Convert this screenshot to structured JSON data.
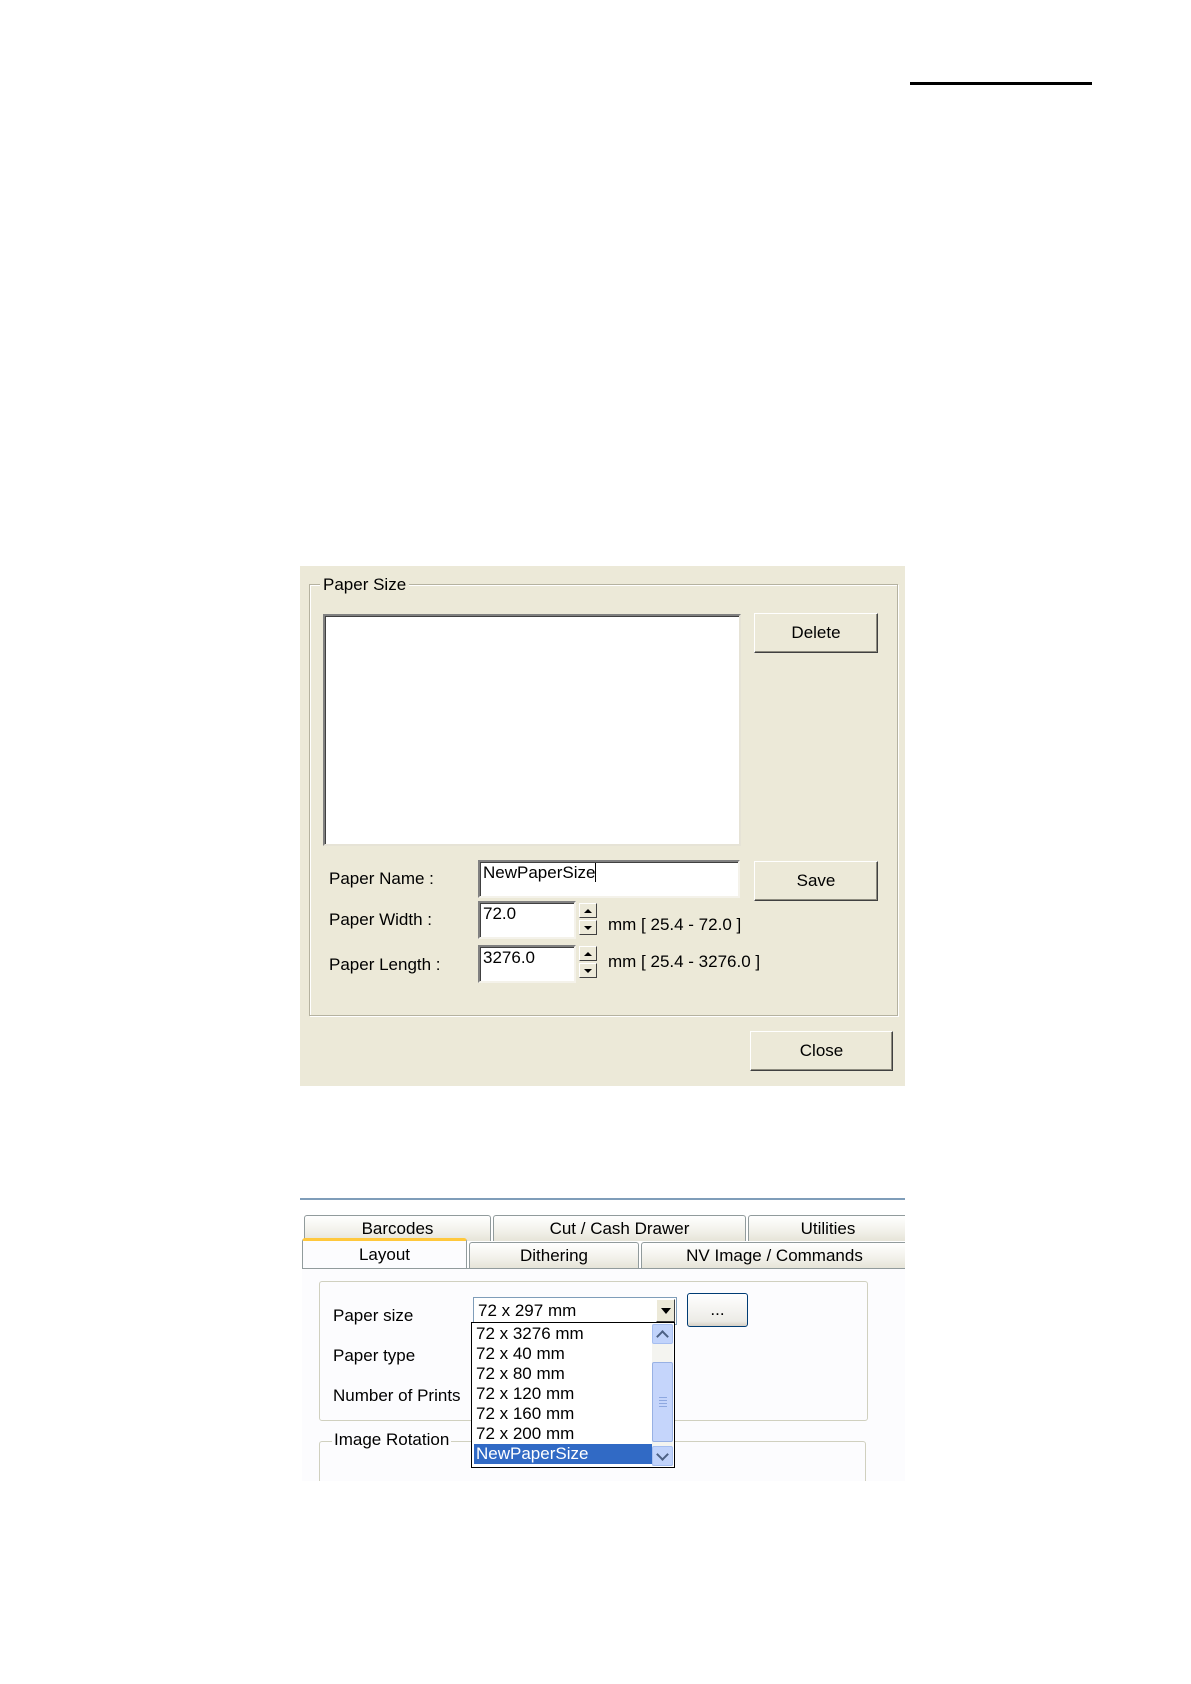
{
  "paper_size_dialog": {
    "group_title": "Paper Size",
    "delete_label": "Delete",
    "save_label": "Save",
    "close_label": "Close",
    "paper_name_label": "Paper Name :",
    "paper_name_value": "NewPaperSize",
    "paper_width_label": "Paper Width :",
    "paper_width_value": "72.0",
    "paper_width_range": "mm [ 25.4 - 72.0 ]",
    "paper_length_label": "Paper Length :",
    "paper_length_value": "3276.0",
    "paper_length_range": "mm [ 25.4 - 3276.0 ]"
  },
  "layout_dialog": {
    "tabs_row1": [
      "Barcodes",
      "Cut / Cash Drawer",
      "Utilities"
    ],
    "tabs_row2": [
      "Layout",
      "Dithering",
      "NV Image / Commands"
    ],
    "active_tab": "Layout",
    "paper_size_label": "Paper size",
    "paper_size_value": "72 x 297 mm",
    "browse_label": "...",
    "paper_type_label": "Paper type",
    "number_of_prints_label": "Number of Prints",
    "image_rotation_label": "Image Rotation",
    "dropdown_options": [
      "72 x 3276 mm",
      "72 x 40 mm",
      "72 x 80 mm",
      "72 x 120 mm",
      "72 x 160 mm",
      "72 x 200 mm",
      "NewPaperSize"
    ],
    "dropdown_selected": "NewPaperSize"
  },
  "colors": {
    "dialog_bg": "#ece9d8",
    "selection": "#316ac5",
    "active_tab_accent": "#ffc83c"
  }
}
